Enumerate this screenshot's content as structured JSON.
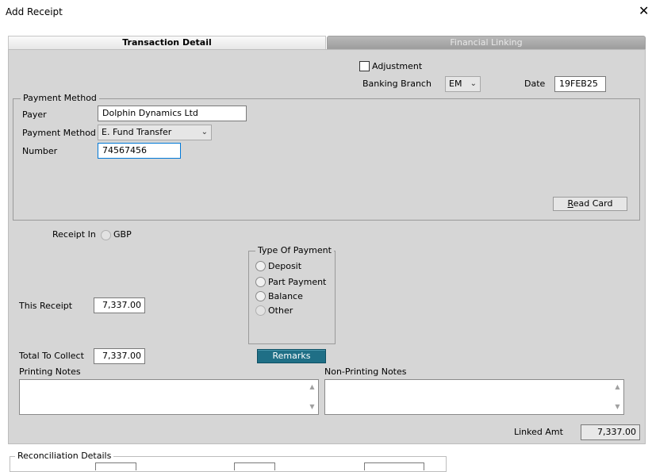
{
  "window": {
    "title": "Add Receipt",
    "close_glyph": "✕"
  },
  "tabs": [
    {
      "label": "Transaction Detail",
      "active": true
    },
    {
      "label": "Financial Linking",
      "active": false
    }
  ],
  "header": {
    "adjustment_label": "Adjustment",
    "adjustment_checked": false,
    "banking_branch_label": "Banking Branch",
    "banking_branch_value": "EM",
    "date_label": "Date",
    "date_value": "19FEB25"
  },
  "payment_method_group": {
    "legend": "Payment Method",
    "payer_label": "Payer",
    "payer_value": "Dolphin Dynamics Ltd",
    "method_label": "Payment Method",
    "method_value": "E. Fund Transfer",
    "number_label": "Number",
    "number_value": "74567456",
    "read_card_label_rest": "ead Card",
    "read_card_mnemonic": "R"
  },
  "receipt_in": {
    "label": "Receipt In",
    "currency": "GBP"
  },
  "type_of_payment": {
    "legend": "Type Of Payment",
    "options": [
      "Deposit",
      "Part Payment",
      "Balance",
      "Other"
    ]
  },
  "amounts": {
    "this_receipt_label": "This Receipt",
    "this_receipt_value": "7,337.00",
    "total_to_collect_label": "Total To Collect",
    "total_to_collect_value": "7,337.00",
    "linked_amt_label": "Linked Amt",
    "linked_amt_value": "7,337.00"
  },
  "remarks_button": "Remarks",
  "notes": {
    "printing_label": "Printing Notes",
    "printing_value": "",
    "non_printing_label": "Non-Printing Notes",
    "non_printing_value": ""
  },
  "reconciliation": {
    "legend": "Reconciliation Details"
  },
  "colors": {
    "panel": "#d6d6d6",
    "accent_button": "#1f6f86",
    "focus_border": "#0078d7"
  }
}
